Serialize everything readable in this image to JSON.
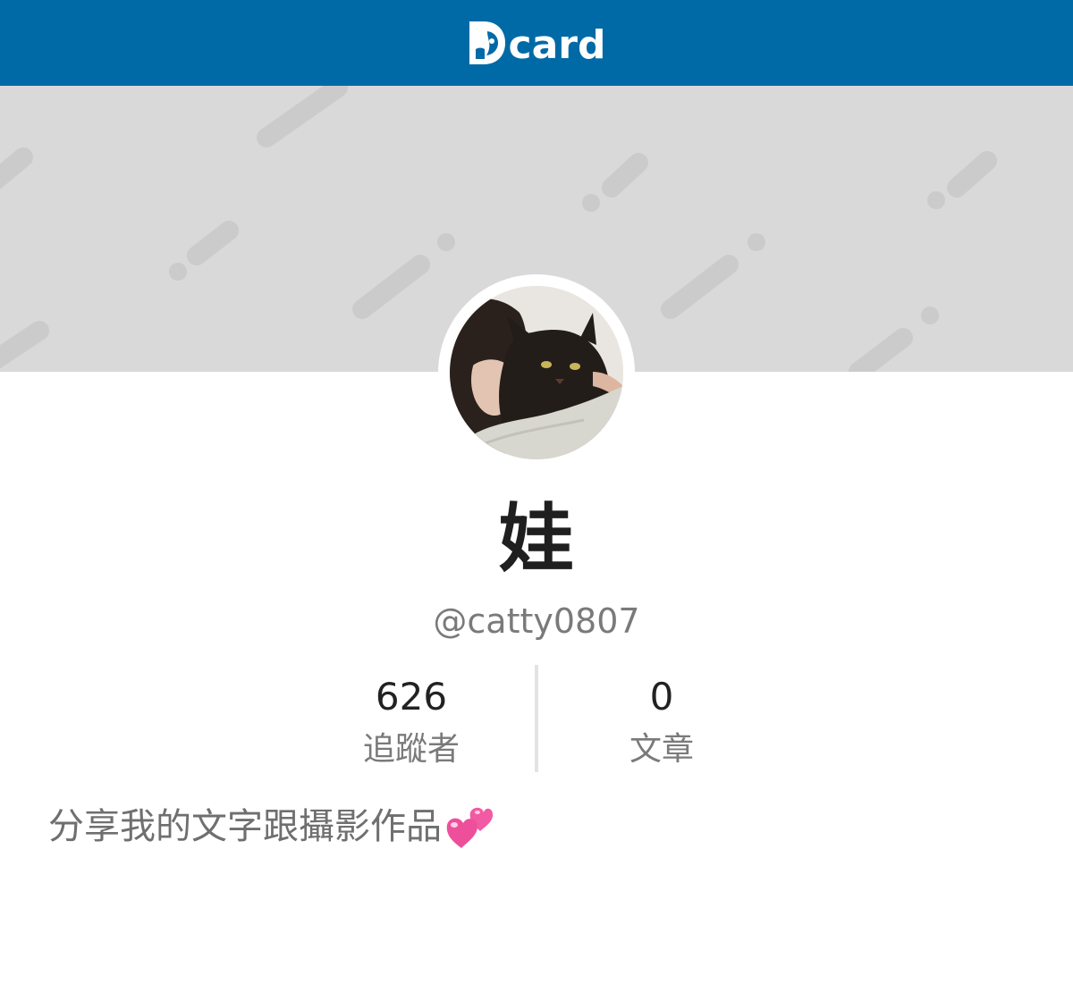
{
  "header": {
    "logo_text": "card",
    "background_color": "#006aa6",
    "logo_icon": "dcard-logo-icon"
  },
  "cover": {
    "background_color": "#d9d9d9",
    "pattern": "diagonal-dash-pattern"
  },
  "profile": {
    "avatar": "avatar-photo-woman-with-cat",
    "name": "娃",
    "handle": "@catty0807",
    "stats": [
      {
        "value": "626",
        "label": "追蹤者"
      },
      {
        "value": "0",
        "label": "文章"
      }
    ],
    "bio": "分享我的文字跟攝影作品",
    "bio_emoji": "two-hearts-icon"
  }
}
